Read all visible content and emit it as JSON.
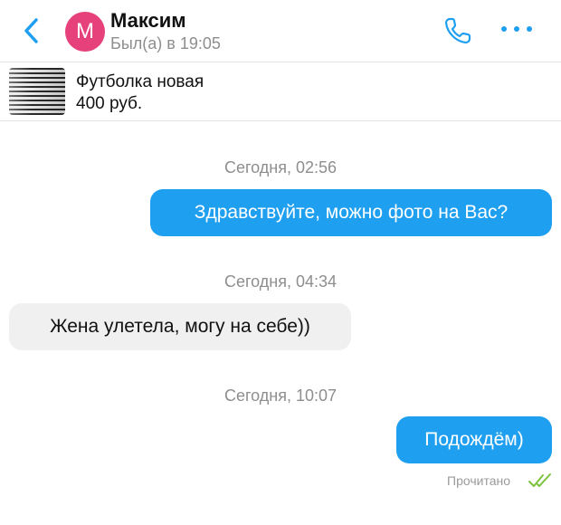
{
  "header": {
    "contact_name": "Максим",
    "avatar_letter": "М",
    "status": "Был(а) в 19:05",
    "avatar_color": "#e6417b",
    "accent_color": "#1f9ff0",
    "icons": [
      "back-chevron-icon",
      "phone-icon",
      "more-dots-icon"
    ]
  },
  "product": {
    "title": "Футболка новая",
    "price": "400 руб."
  },
  "messages": [
    {
      "timestamp": "Сегодня, 02:56",
      "direction": "outgoing",
      "text": "Здравствуйте, можно фото на Вас?"
    },
    {
      "timestamp": "Сегодня, 04:34",
      "direction": "incoming",
      "text": "Жена улетела, могу на себе))"
    },
    {
      "timestamp": "Сегодня, 10:07",
      "direction": "outgoing",
      "text": "Подождём)"
    }
  ],
  "read_receipt": {
    "label": "Прочитано",
    "icon": "double-check-icon",
    "color": "#7cc23c"
  }
}
